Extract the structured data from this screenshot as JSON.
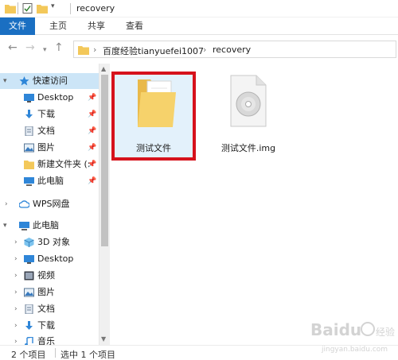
{
  "window": {
    "title": "recovery"
  },
  "ribbon": {
    "tabs": [
      "文件",
      "主页",
      "共享",
      "查看"
    ]
  },
  "address": {
    "breadcrumbs": [
      "百度经验tianyuefei1007",
      "recovery"
    ]
  },
  "sidebar": {
    "items": [
      {
        "label": "快速访问",
        "icon": "star-icon",
        "pinned": false
      },
      {
        "label": "Desktop",
        "icon": "desktop-icon",
        "pinned": true
      },
      {
        "label": "下载",
        "icon": "download-icon",
        "pinned": true
      },
      {
        "label": "文档",
        "icon": "document-icon",
        "pinned": true
      },
      {
        "label": "图片",
        "icon": "picture-icon",
        "pinned": true
      },
      {
        "label": "新建文件夹 (:",
        "icon": "folder-icon",
        "pinned": true
      },
      {
        "label": "此电脑",
        "icon": "computer-icon",
        "pinned": true
      },
      {
        "label": "WPS网盘",
        "icon": "cloud-icon",
        "pinned": false
      },
      {
        "label": "此电脑",
        "icon": "computer-icon",
        "pinned": false
      },
      {
        "label": "3D 对象",
        "icon": "cube-icon",
        "pinned": false
      },
      {
        "label": "Desktop",
        "icon": "desktop-icon",
        "pinned": false
      },
      {
        "label": "视频",
        "icon": "video-icon",
        "pinned": false
      },
      {
        "label": "图片",
        "icon": "picture-icon",
        "pinned": false
      },
      {
        "label": "文档",
        "icon": "document-icon",
        "pinned": false
      },
      {
        "label": "下载",
        "icon": "download-icon",
        "pinned": false
      },
      {
        "label": "音乐",
        "icon": "music-icon",
        "pinned": false
      }
    ]
  },
  "files": [
    {
      "name": "测试文件",
      "type": "folder",
      "selected": true
    },
    {
      "name": "测试文件.img",
      "type": "disc-image",
      "selected": false
    }
  ],
  "status": {
    "count": "2 个项目",
    "selection": "选中 1 个项目"
  },
  "watermark": {
    "brand": "Baidu",
    "sub": "jingyan.baidu.com"
  },
  "colors": {
    "accent": "#1a6fc2",
    "selection": "#cce5f7",
    "highlight_box": "#d6121c",
    "folder": "#f3c85a"
  }
}
